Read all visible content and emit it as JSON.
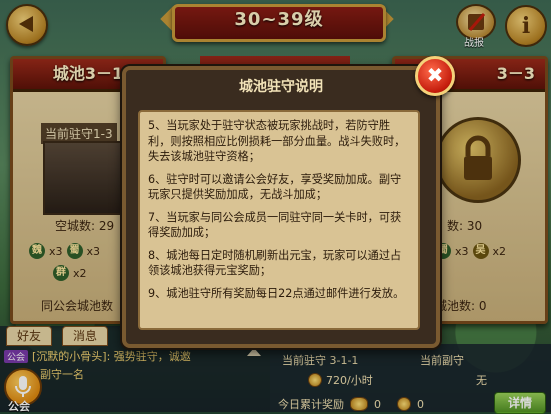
{
  "header": {
    "level_title": "30~39级",
    "battle_report_label": "战报",
    "info_glyph": "i"
  },
  "city_panels": {
    "left": {
      "title": "城池3－1",
      "current_defender": "当前驻守1-3",
      "empty_count": "空城数: 29",
      "factions": [
        {
          "name": "魏",
          "count": "x3"
        },
        {
          "name": "蜀",
          "count": "x3"
        },
        {
          "name": "吴",
          "count": "x2"
        },
        {
          "name": "群",
          "count": "x2"
        }
      ],
      "guild_cities": "同公会城池数"
    },
    "right": {
      "title": "3－3",
      "empty_count": "数: 30",
      "factions": [
        {
          "name": "蜀",
          "count": "x3"
        },
        {
          "name": "吴",
          "count": "x2"
        }
      ],
      "guild_cities": "城池数: 0"
    }
  },
  "modal": {
    "title": "城池驻守说明",
    "close_glyph": "✖",
    "paragraphs": [
      "5、当玩家处于驻守状态被玩家挑战时，若防守胜利，则按照相应比例损耗一部分血量。战斗失败时，失去该城池驻守资格；",
      "6、驻守时可以邀请公会好友，享受奖励加成。副守玩家只提供奖励加成，无战斗加成；",
      "7、当玩家与同公会成员一同驻守同一关卡时，可获得奖励加成；",
      "8、城池每日定时随机刷新出元宝，玩家可以通过占领该城池获得元宝奖励；",
      "9、城池驻守所有奖励每日22点通过邮件进行发放。"
    ]
  },
  "bottom": {
    "tabs": [
      "好友",
      "消息"
    ],
    "guild_tag": "公会",
    "chat_message": "[沉默的小骨头]: 强势驻守，诚邀",
    "chat_message_line2": "副守一名",
    "mic_label": "公会",
    "current_defend_label": "当前驻守 3-1-1",
    "current_vice_label": "当前副守",
    "rate": "720/小时",
    "vice_value": "无",
    "daily_reward_label": "今日累计奖励",
    "daily_reward_value1": "0",
    "daily_reward_value2": "0",
    "detail_button": "详情"
  }
}
